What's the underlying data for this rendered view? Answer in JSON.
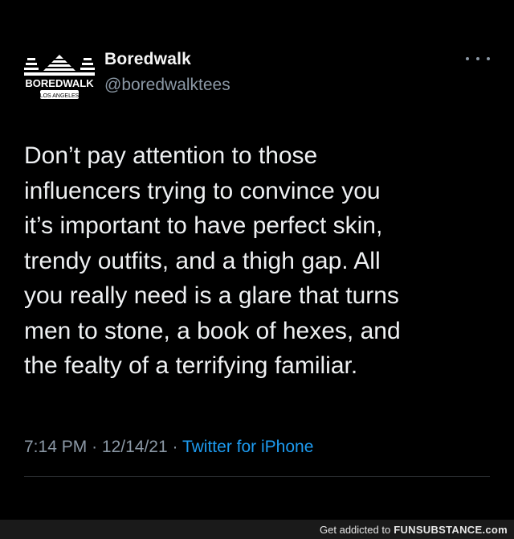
{
  "author": {
    "name": "Boredwalk",
    "handle": "@boredwalktees",
    "avatar": {
      "icon": "boredwalk-logo-icon",
      "wordmark": "BOREDWALK",
      "subtext": "LOS ANGELES"
    }
  },
  "more_icon": "more-horizontal-icon",
  "tweet": {
    "lines": [
      "Don’t pay attention to those",
      "influencers trying to convince you",
      "it’s important to have perfect skin,",
      "trendy outfits, and a thigh gap. All",
      "you really need is a glare that turns",
      "men to stone, a book of hexes, and",
      "the fealty of a terrifying familiar."
    ]
  },
  "meta": {
    "time": "7:14 PM",
    "separator": "·",
    "date": "12/14/21",
    "source": "Twitter for iPhone"
  },
  "watermark": {
    "prefix": "Get addicted to",
    "brand": "FUNSUBSTANCE",
    "suffix": ".com"
  },
  "colors": {
    "background": "#000000",
    "text": "#eef0f2",
    "secondary": "#8b98a5",
    "link": "#1d9bf0"
  }
}
